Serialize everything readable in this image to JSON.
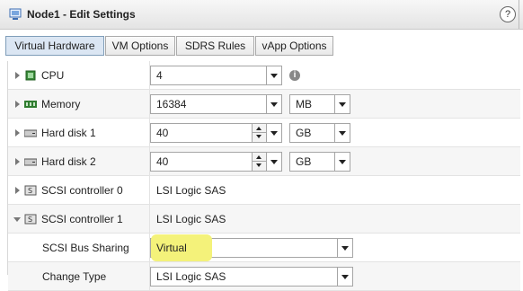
{
  "window": {
    "title": "Node1 - Edit Settings",
    "help_label": "?"
  },
  "tabs": [
    {
      "label": "Virtual Hardware",
      "active": true
    },
    {
      "label": "VM Options"
    },
    {
      "label": "SDRS Rules"
    },
    {
      "label": "vApp Options"
    }
  ],
  "rows": {
    "cpu": {
      "label": "CPU",
      "value": "4"
    },
    "memory": {
      "label": "Memory",
      "value": "16384",
      "unit": "MB"
    },
    "disk1": {
      "label": "Hard disk 1",
      "value": "40",
      "unit": "GB"
    },
    "disk2": {
      "label": "Hard disk 2",
      "value": "40",
      "unit": "GB"
    },
    "scsi0": {
      "label": "SCSI controller 0",
      "value": "LSI Logic SAS"
    },
    "scsi1": {
      "label": "SCSI controller 1",
      "value": "LSI Logic SAS"
    },
    "bus": {
      "label": "SCSI Bus Sharing",
      "value": "Virtual"
    },
    "change": {
      "label": "Change Type",
      "value": "LSI Logic SAS"
    }
  },
  "colors": {
    "highlight": "#f4f27a",
    "active_tab": "#dbe6f3"
  }
}
